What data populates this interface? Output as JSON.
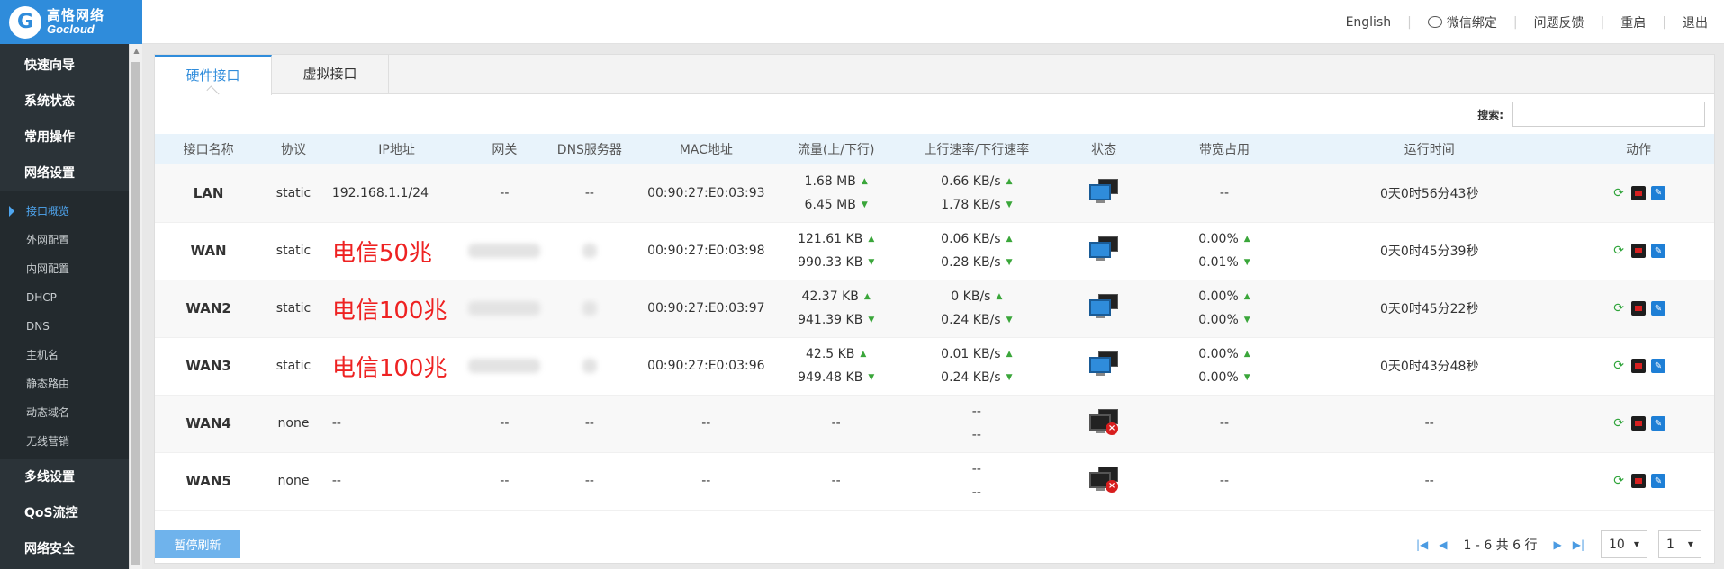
{
  "brand": {
    "logo_glyph": "G",
    "name_cn": "高恪网络",
    "name_en": "Gocloud",
    "color": "#2f8cdb"
  },
  "topnav": [
    {
      "label": "English"
    },
    {
      "label": "微信绑定",
      "icon": "wechat-icon"
    },
    {
      "label": "问题反馈"
    },
    {
      "label": "重启"
    },
    {
      "label": "退出"
    }
  ],
  "sidebar": {
    "menu_top": [
      "快速向导",
      "系统状态",
      "常用操作",
      "网络设置"
    ],
    "sub_items": [
      "接口概览",
      "外网配置",
      "内网配置",
      "DHCP",
      "DNS",
      "主机名",
      "静态路由",
      "动态域名",
      "无线营销"
    ],
    "active_sub": "接口概览",
    "menu_bottom": [
      "多线设置",
      "QoS流控",
      "网络安全"
    ]
  },
  "tabs": [
    {
      "label": "硬件接口",
      "active": true
    },
    {
      "label": "虚拟接口",
      "active": false
    }
  ],
  "search": {
    "label": "搜索:",
    "value": "",
    "placeholder": ""
  },
  "table": {
    "headers": [
      "接口名称",
      "协议",
      "IP地址",
      "网关",
      "DNS服务器",
      "MAC地址",
      "流量(上/下行)",
      "上行速率/下行速率",
      "状态",
      "带宽占用",
      "运行时间",
      "动作"
    ],
    "rows": [
      {
        "name": "LAN",
        "proto": "static",
        "ip": "192.168.1.1/24",
        "memo": "",
        "gateway": "--",
        "dns": "--",
        "mac": "00:90:27:E0:03:93",
        "traffic_up": "1.68 MB",
        "traffic_down": "6.45 MB",
        "rate_up": "0.66 KB/s",
        "rate_down": "1.78 KB/s",
        "status": "connected",
        "bw_up": "",
        "bw_down": "",
        "bw_single": "--",
        "uptime": "0天0时56分43秒"
      },
      {
        "name": "WAN",
        "proto": "static",
        "ip": "",
        "memo": "电信50兆",
        "gateway": "",
        "dns": "",
        "mac": "00:90:27:E0:03:98",
        "traffic_up": "121.61 KB",
        "traffic_down": "990.33 KB",
        "rate_up": "0.06 KB/s",
        "rate_down": "0.28 KB/s",
        "status": "connected",
        "bw_up": "0.00%",
        "bw_down": "0.01%",
        "bw_single": "",
        "uptime": "0天0时45分39秒"
      },
      {
        "name": "WAN2",
        "proto": "static",
        "ip": "",
        "memo": "电信100兆",
        "gateway": "",
        "dns": "",
        "mac": "00:90:27:E0:03:97",
        "traffic_up": "42.37 KB",
        "traffic_down": "941.39 KB",
        "rate_up": "0 KB/s",
        "rate_down": "0.24 KB/s",
        "status": "connected",
        "bw_up": "0.00%",
        "bw_down": "0.00%",
        "bw_single": "",
        "uptime": "0天0时45分22秒"
      },
      {
        "name": "WAN3",
        "proto": "static",
        "ip": "",
        "memo": "电信100兆",
        "gateway": "",
        "dns": "",
        "mac": "00:90:27:E0:03:96",
        "traffic_up": "42.5 KB",
        "traffic_down": "949.48 KB",
        "rate_up": "0.01 KB/s",
        "rate_down": "0.24 KB/s",
        "status": "connected",
        "bw_up": "0.00%",
        "bw_down": "0.00%",
        "bw_single": "",
        "uptime": "0天0时43分48秒"
      },
      {
        "name": "WAN4",
        "proto": "none",
        "ip": "--",
        "memo": "",
        "gateway": "--",
        "dns": "--",
        "mac": "--",
        "traffic_single": "--",
        "rate_up": "--",
        "rate_down": "--",
        "status": "disconnected",
        "bw_single": "--",
        "uptime": "--"
      },
      {
        "name": "WAN5",
        "proto": "none",
        "ip": "--",
        "memo": "",
        "gateway": "--",
        "dns": "--",
        "mac": "--",
        "traffic_single": "--",
        "rate_up": "--",
        "rate_down": "--",
        "status": "disconnected",
        "bw_single": "--",
        "uptime": "--"
      }
    ]
  },
  "footer": {
    "pause_label": "暂停刷新",
    "page_info": "1 - 6 共 6 行",
    "page_size": "10",
    "page_number": "1"
  },
  "colors": {
    "accent": "#2f8cdb",
    "sidebar_bg": "#2b3338",
    "memo_text": "#ee2222",
    "arrow_green": "#3aa63a",
    "header_row": "#e8f3fb"
  }
}
